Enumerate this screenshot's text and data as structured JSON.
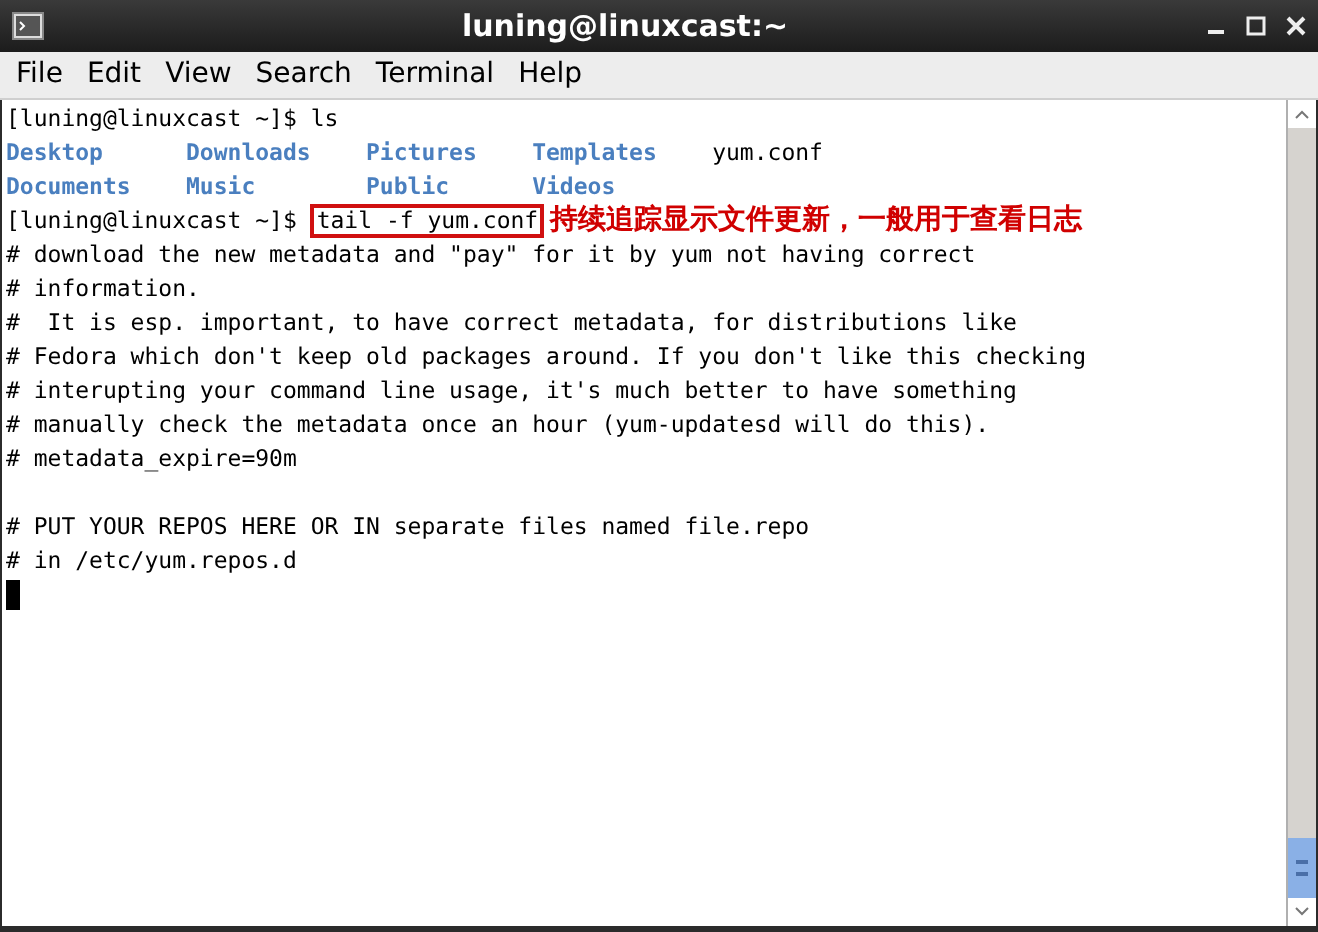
{
  "window": {
    "title": "luning@linuxcast:~"
  },
  "menu": [
    "File",
    "Edit",
    "View",
    "Search",
    "Terminal",
    "Help"
  ],
  "lines": [
    {
      "kind": "prompt",
      "prompt": "[luning@linuxcast ~]$ ",
      "command": "ls"
    },
    {
      "kind": "listing",
      "entries": [
        {
          "name": "Desktop",
          "directory": true
        },
        {
          "name": "Downloads",
          "directory": true
        },
        {
          "name": "Pictures",
          "directory": true
        },
        {
          "name": "Templates",
          "directory": true
        },
        {
          "name": "yum.conf",
          "directory": false
        }
      ]
    },
    {
      "kind": "listing",
      "entries": [
        {
          "name": "Documents",
          "directory": true
        },
        {
          "name": "Music",
          "directory": true
        },
        {
          "name": "Public",
          "directory": true
        },
        {
          "name": "Videos",
          "directory": true
        }
      ]
    },
    {
      "kind": "prompt",
      "prompt": "[luning@linuxcast ~]$ ",
      "command": "tail -f yum.conf",
      "annotation": "持续追踪显示文件更新，一般用于查看日志"
    },
    {
      "kind": "output",
      "text": "# download the new metadata and \"pay\" for it by yum not having correct"
    },
    {
      "kind": "output",
      "text": "# information."
    },
    {
      "kind": "output",
      "text": "#  It is esp. important, to have correct metadata, for distributions like"
    },
    {
      "kind": "output",
      "text": "# Fedora which don't keep old packages around. If you don't like this checking"
    },
    {
      "kind": "output",
      "text": "# interupting your command line usage, it's much better to have something"
    },
    {
      "kind": "output",
      "text": "# manually check the metadata once an hour (yum-updatesd will do this)."
    },
    {
      "kind": "output",
      "text": "# metadata_expire=90m"
    },
    {
      "kind": "blank"
    },
    {
      "kind": "output",
      "text": "# PUT YOUR REPOS HERE OR IN separate files named file.repo"
    },
    {
      "kind": "output",
      "text": "# in /etc/yum.repos.d"
    },
    {
      "kind": "cursor"
    }
  ]
}
